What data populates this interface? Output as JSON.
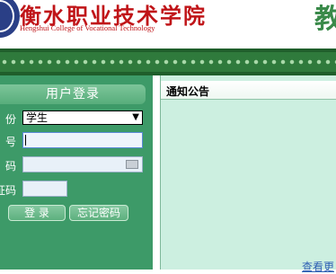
{
  "header": {
    "school_name_cn": "衡水职业技术学院",
    "school_name_en": "Hengshui College of Vocational Technology",
    "system_title_partial": "教"
  },
  "login": {
    "title": "用户登录",
    "identity_label": "份",
    "identity_value": "学生",
    "account_label": "号",
    "password_label": "码",
    "captcha_label": "证码",
    "login_button": "登 录",
    "forgot_button": "忘记密码"
  },
  "notice": {
    "title": "通知公告",
    "more_link": "查看更"
  },
  "colors": {
    "brand_red": "#c01418",
    "panel_green": "#3d9a68",
    "notice_bg": "#ccefe0"
  }
}
